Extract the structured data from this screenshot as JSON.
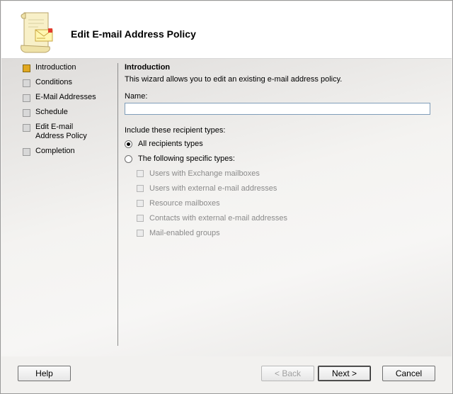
{
  "window": {
    "title": "Edit E-mail Address Policy"
  },
  "steps": [
    {
      "label": "Introduction",
      "active": true
    },
    {
      "label": "Conditions",
      "active": false
    },
    {
      "label": "E-Mail Addresses",
      "active": false
    },
    {
      "label": "Schedule",
      "active": false
    },
    {
      "label": "Edit E-mail Address Policy",
      "active": false
    },
    {
      "label": "Completion",
      "active": false
    }
  ],
  "main": {
    "section_title": "Introduction",
    "description": "This wizard allows you to edit an existing e-mail address policy.",
    "name_label": "Name:",
    "name_value": "",
    "include_label": "Include these recipient types:",
    "radio_all": "All recipients types",
    "radio_specific": "The following specific types:",
    "selected_radio": "all",
    "checkboxes": [
      {
        "label": "Users with Exchange mailboxes",
        "checked": false,
        "enabled": false
      },
      {
        "label": "Users with external e-mail addresses",
        "checked": false,
        "enabled": false
      },
      {
        "label": "Resource mailboxes",
        "checked": false,
        "enabled": false
      },
      {
        "label": "Contacts with external e-mail addresses",
        "checked": false,
        "enabled": false
      },
      {
        "label": "Mail-enabled groups",
        "checked": false,
        "enabled": false
      }
    ]
  },
  "buttons": {
    "help": "Help",
    "back": "< Back",
    "next": "Next >",
    "cancel": "Cancel"
  },
  "colors": {
    "active_step": "#e1a821",
    "inactive_step": "#d8d8d8",
    "disabled_text": "#8a8a8a"
  }
}
